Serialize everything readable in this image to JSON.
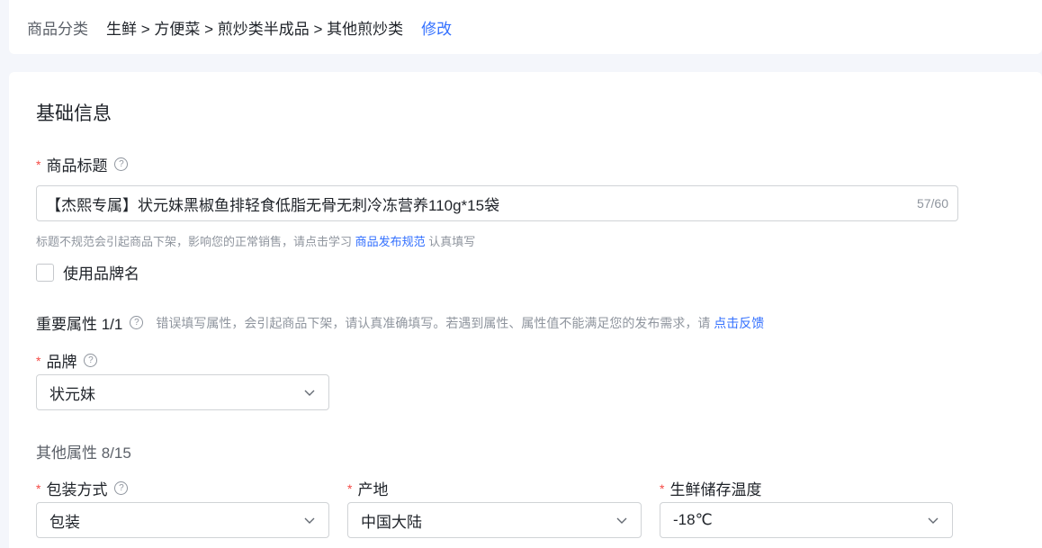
{
  "breadcrumb": {
    "label": "商品分类",
    "path": "生鲜 > 方便菜 > 煎炒类半成品 > 其他煎炒类",
    "edit_link": "修改"
  },
  "basic_info": {
    "section_title": "基础信息",
    "title_field": {
      "required_mark": "*",
      "label": "商品标题",
      "help_icon": "?",
      "value": "【杰熙专属】状元妹黑椒鱼排轻食低脂无骨无刺冷冻营养110g*15袋",
      "counter": "57/60"
    },
    "hint": {
      "text": "标题不规范会引起商品下架，影响您的正常销售，请点击学习",
      "link": "商品发布规范",
      "suffix": "认真填写"
    },
    "brand_checkbox_label": "使用品牌名"
  },
  "important_attrs": {
    "title": "重要属性 1/1",
    "help_icon": "?",
    "desc": "错误填写属性，会引起商品下架，请认真准确填写。若遇到属性、属性值不能满足您的发布需求，请",
    "feedback_link": "点击反馈",
    "brand": {
      "required_mark": "*",
      "label": "品牌",
      "help_icon": "?",
      "value": "状元妹"
    }
  },
  "other_attrs": {
    "title": "其他属性 8/15",
    "packaging": {
      "required_mark": "*",
      "label": "包装方式",
      "help_icon": "?",
      "value": "包装"
    },
    "origin": {
      "required_mark": "*",
      "label": "产地",
      "value": "中国大陆"
    },
    "storage_temp": {
      "required_mark": "*",
      "label": "生鲜储存温度",
      "value": "-18℃"
    }
  },
  "colors": {
    "accent": "#3370ff",
    "required": "#f54a45",
    "muted": "#8f959e"
  },
  "icons": {
    "help": "help-icon",
    "chevron": "chevron-down-icon"
  }
}
